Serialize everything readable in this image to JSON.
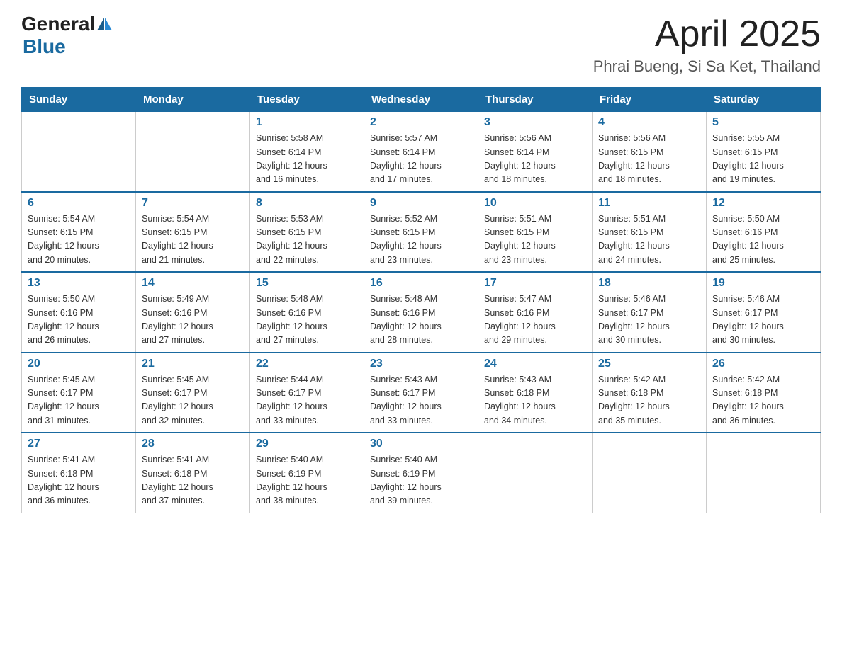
{
  "header": {
    "logo_general": "General",
    "logo_blue": "Blue",
    "title": "April 2025",
    "subtitle": "Phrai Bueng, Si Sa Ket, Thailand"
  },
  "calendar": {
    "days_of_week": [
      "Sunday",
      "Monday",
      "Tuesday",
      "Wednesday",
      "Thursday",
      "Friday",
      "Saturday"
    ],
    "weeks": [
      [
        {
          "day": "",
          "info": ""
        },
        {
          "day": "",
          "info": ""
        },
        {
          "day": "1",
          "info": "Sunrise: 5:58 AM\nSunset: 6:14 PM\nDaylight: 12 hours\nand 16 minutes."
        },
        {
          "day": "2",
          "info": "Sunrise: 5:57 AM\nSunset: 6:14 PM\nDaylight: 12 hours\nand 17 minutes."
        },
        {
          "day": "3",
          "info": "Sunrise: 5:56 AM\nSunset: 6:14 PM\nDaylight: 12 hours\nand 18 minutes."
        },
        {
          "day": "4",
          "info": "Sunrise: 5:56 AM\nSunset: 6:15 PM\nDaylight: 12 hours\nand 18 minutes."
        },
        {
          "day": "5",
          "info": "Sunrise: 5:55 AM\nSunset: 6:15 PM\nDaylight: 12 hours\nand 19 minutes."
        }
      ],
      [
        {
          "day": "6",
          "info": "Sunrise: 5:54 AM\nSunset: 6:15 PM\nDaylight: 12 hours\nand 20 minutes."
        },
        {
          "day": "7",
          "info": "Sunrise: 5:54 AM\nSunset: 6:15 PM\nDaylight: 12 hours\nand 21 minutes."
        },
        {
          "day": "8",
          "info": "Sunrise: 5:53 AM\nSunset: 6:15 PM\nDaylight: 12 hours\nand 22 minutes."
        },
        {
          "day": "9",
          "info": "Sunrise: 5:52 AM\nSunset: 6:15 PM\nDaylight: 12 hours\nand 23 minutes."
        },
        {
          "day": "10",
          "info": "Sunrise: 5:51 AM\nSunset: 6:15 PM\nDaylight: 12 hours\nand 23 minutes."
        },
        {
          "day": "11",
          "info": "Sunrise: 5:51 AM\nSunset: 6:15 PM\nDaylight: 12 hours\nand 24 minutes."
        },
        {
          "day": "12",
          "info": "Sunrise: 5:50 AM\nSunset: 6:16 PM\nDaylight: 12 hours\nand 25 minutes."
        }
      ],
      [
        {
          "day": "13",
          "info": "Sunrise: 5:50 AM\nSunset: 6:16 PM\nDaylight: 12 hours\nand 26 minutes."
        },
        {
          "day": "14",
          "info": "Sunrise: 5:49 AM\nSunset: 6:16 PM\nDaylight: 12 hours\nand 27 minutes."
        },
        {
          "day": "15",
          "info": "Sunrise: 5:48 AM\nSunset: 6:16 PM\nDaylight: 12 hours\nand 27 minutes."
        },
        {
          "day": "16",
          "info": "Sunrise: 5:48 AM\nSunset: 6:16 PM\nDaylight: 12 hours\nand 28 minutes."
        },
        {
          "day": "17",
          "info": "Sunrise: 5:47 AM\nSunset: 6:16 PM\nDaylight: 12 hours\nand 29 minutes."
        },
        {
          "day": "18",
          "info": "Sunrise: 5:46 AM\nSunset: 6:17 PM\nDaylight: 12 hours\nand 30 minutes."
        },
        {
          "day": "19",
          "info": "Sunrise: 5:46 AM\nSunset: 6:17 PM\nDaylight: 12 hours\nand 30 minutes."
        }
      ],
      [
        {
          "day": "20",
          "info": "Sunrise: 5:45 AM\nSunset: 6:17 PM\nDaylight: 12 hours\nand 31 minutes."
        },
        {
          "day": "21",
          "info": "Sunrise: 5:45 AM\nSunset: 6:17 PM\nDaylight: 12 hours\nand 32 minutes."
        },
        {
          "day": "22",
          "info": "Sunrise: 5:44 AM\nSunset: 6:17 PM\nDaylight: 12 hours\nand 33 minutes."
        },
        {
          "day": "23",
          "info": "Sunrise: 5:43 AM\nSunset: 6:17 PM\nDaylight: 12 hours\nand 33 minutes."
        },
        {
          "day": "24",
          "info": "Sunrise: 5:43 AM\nSunset: 6:18 PM\nDaylight: 12 hours\nand 34 minutes."
        },
        {
          "day": "25",
          "info": "Sunrise: 5:42 AM\nSunset: 6:18 PM\nDaylight: 12 hours\nand 35 minutes."
        },
        {
          "day": "26",
          "info": "Sunrise: 5:42 AM\nSunset: 6:18 PM\nDaylight: 12 hours\nand 36 minutes."
        }
      ],
      [
        {
          "day": "27",
          "info": "Sunrise: 5:41 AM\nSunset: 6:18 PM\nDaylight: 12 hours\nand 36 minutes."
        },
        {
          "day": "28",
          "info": "Sunrise: 5:41 AM\nSunset: 6:18 PM\nDaylight: 12 hours\nand 37 minutes."
        },
        {
          "day": "29",
          "info": "Sunrise: 5:40 AM\nSunset: 6:19 PM\nDaylight: 12 hours\nand 38 minutes."
        },
        {
          "day": "30",
          "info": "Sunrise: 5:40 AM\nSunset: 6:19 PM\nDaylight: 12 hours\nand 39 minutes."
        },
        {
          "day": "",
          "info": ""
        },
        {
          "day": "",
          "info": ""
        },
        {
          "day": "",
          "info": ""
        }
      ]
    ]
  }
}
